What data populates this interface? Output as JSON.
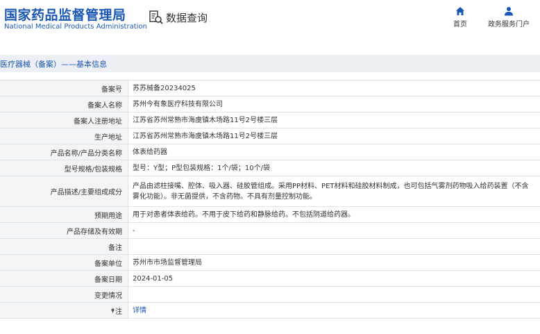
{
  "header": {
    "logo_cn": "国家药品监督管理局",
    "logo_en": "National Medical Products Administration",
    "query_title": "数据查询",
    "nav": [
      {
        "label": "首页",
        "icon": "home-icon"
      },
      {
        "label": "政务服务门户",
        "icon": "user-icon"
      }
    ],
    "brand_color": "#1a57b5"
  },
  "breadcrumb": "医疗器械（备案）——基本信息",
  "rows": [
    {
      "label": "备案号",
      "value": "苏苏械备20234025"
    },
    {
      "label": "备案人名称",
      "value": "苏州今有象医疗科技有限公司"
    },
    {
      "label": "备案人注册地址",
      "value": "江苏省苏州常熟市海虞镇木场路11号2号楼三层"
    },
    {
      "label": "生产地址",
      "value": "江苏省苏州常熟市海虞镇木场路11号2号楼三层"
    },
    {
      "label": "产品名称/产品分类名称",
      "value": "体表给药器"
    },
    {
      "label": "型号规格/包装规格",
      "value": "型号：Y型；P型包装规格：1个/袋；10个/袋"
    },
    {
      "label": "产品描述/主要组成成分",
      "value": "产品由滤柱接嘴、腔体、吸入器、硅胶管组成。采用PP材料、PET材料和硅胶材料制成，也可包括气雾剂药物吸入给药装置（不含雾化功能）。非无菌提供，不含药物。不具有剂量控制功能。"
    },
    {
      "label": "预期用途",
      "value": "用于对患者体表给药。不用于皮下给药和静脉给药。不包括阴道给药器。"
    },
    {
      "label": "产品存储及有效期",
      "value": "-"
    },
    {
      "label": "备注",
      "value": ""
    },
    {
      "label": "备案单位",
      "value": "苏州市市场监督管理局"
    },
    {
      "label": "备案日期",
      "value": "2024-01-05"
    },
    {
      "label": "变更情况",
      "value": ""
    },
    {
      "label": "注",
      "value": "详情"
    }
  ]
}
